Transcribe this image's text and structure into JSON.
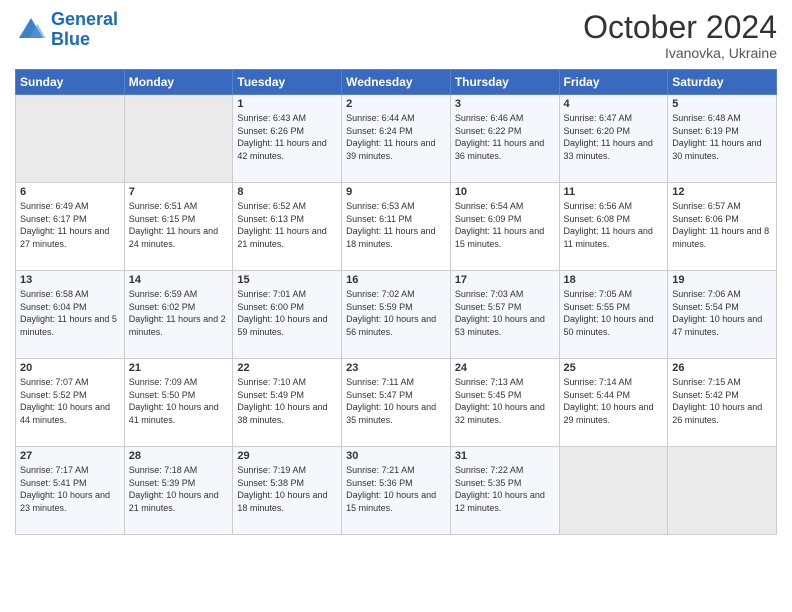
{
  "header": {
    "logo_line1": "General",
    "logo_line2": "Blue",
    "month": "October 2024",
    "location": "Ivanovka, Ukraine"
  },
  "weekdays": [
    "Sunday",
    "Monday",
    "Tuesday",
    "Wednesday",
    "Thursday",
    "Friday",
    "Saturday"
  ],
  "weeks": [
    [
      {
        "day": "",
        "info": ""
      },
      {
        "day": "",
        "info": ""
      },
      {
        "day": "1",
        "info": "Sunrise: 6:43 AM\nSunset: 6:26 PM\nDaylight: 11 hours and 42 minutes."
      },
      {
        "day": "2",
        "info": "Sunrise: 6:44 AM\nSunset: 6:24 PM\nDaylight: 11 hours and 39 minutes."
      },
      {
        "day": "3",
        "info": "Sunrise: 6:46 AM\nSunset: 6:22 PM\nDaylight: 11 hours and 36 minutes."
      },
      {
        "day": "4",
        "info": "Sunrise: 6:47 AM\nSunset: 6:20 PM\nDaylight: 11 hours and 33 minutes."
      },
      {
        "day": "5",
        "info": "Sunrise: 6:48 AM\nSunset: 6:19 PM\nDaylight: 11 hours and 30 minutes."
      }
    ],
    [
      {
        "day": "6",
        "info": "Sunrise: 6:49 AM\nSunset: 6:17 PM\nDaylight: 11 hours and 27 minutes."
      },
      {
        "day": "7",
        "info": "Sunrise: 6:51 AM\nSunset: 6:15 PM\nDaylight: 11 hours and 24 minutes."
      },
      {
        "day": "8",
        "info": "Sunrise: 6:52 AM\nSunset: 6:13 PM\nDaylight: 11 hours and 21 minutes."
      },
      {
        "day": "9",
        "info": "Sunrise: 6:53 AM\nSunset: 6:11 PM\nDaylight: 11 hours and 18 minutes."
      },
      {
        "day": "10",
        "info": "Sunrise: 6:54 AM\nSunset: 6:09 PM\nDaylight: 11 hours and 15 minutes."
      },
      {
        "day": "11",
        "info": "Sunrise: 6:56 AM\nSunset: 6:08 PM\nDaylight: 11 hours and 11 minutes."
      },
      {
        "day": "12",
        "info": "Sunrise: 6:57 AM\nSunset: 6:06 PM\nDaylight: 11 hours and 8 minutes."
      }
    ],
    [
      {
        "day": "13",
        "info": "Sunrise: 6:58 AM\nSunset: 6:04 PM\nDaylight: 11 hours and 5 minutes."
      },
      {
        "day": "14",
        "info": "Sunrise: 6:59 AM\nSunset: 6:02 PM\nDaylight: 11 hours and 2 minutes."
      },
      {
        "day": "15",
        "info": "Sunrise: 7:01 AM\nSunset: 6:00 PM\nDaylight: 10 hours and 59 minutes."
      },
      {
        "day": "16",
        "info": "Sunrise: 7:02 AM\nSunset: 5:59 PM\nDaylight: 10 hours and 56 minutes."
      },
      {
        "day": "17",
        "info": "Sunrise: 7:03 AM\nSunset: 5:57 PM\nDaylight: 10 hours and 53 minutes."
      },
      {
        "day": "18",
        "info": "Sunrise: 7:05 AM\nSunset: 5:55 PM\nDaylight: 10 hours and 50 minutes."
      },
      {
        "day": "19",
        "info": "Sunrise: 7:06 AM\nSunset: 5:54 PM\nDaylight: 10 hours and 47 minutes."
      }
    ],
    [
      {
        "day": "20",
        "info": "Sunrise: 7:07 AM\nSunset: 5:52 PM\nDaylight: 10 hours and 44 minutes."
      },
      {
        "day": "21",
        "info": "Sunrise: 7:09 AM\nSunset: 5:50 PM\nDaylight: 10 hours and 41 minutes."
      },
      {
        "day": "22",
        "info": "Sunrise: 7:10 AM\nSunset: 5:49 PM\nDaylight: 10 hours and 38 minutes."
      },
      {
        "day": "23",
        "info": "Sunrise: 7:11 AM\nSunset: 5:47 PM\nDaylight: 10 hours and 35 minutes."
      },
      {
        "day": "24",
        "info": "Sunrise: 7:13 AM\nSunset: 5:45 PM\nDaylight: 10 hours and 32 minutes."
      },
      {
        "day": "25",
        "info": "Sunrise: 7:14 AM\nSunset: 5:44 PM\nDaylight: 10 hours and 29 minutes."
      },
      {
        "day": "26",
        "info": "Sunrise: 7:15 AM\nSunset: 5:42 PM\nDaylight: 10 hours and 26 minutes."
      }
    ],
    [
      {
        "day": "27",
        "info": "Sunrise: 7:17 AM\nSunset: 5:41 PM\nDaylight: 10 hours and 23 minutes."
      },
      {
        "day": "28",
        "info": "Sunrise: 7:18 AM\nSunset: 5:39 PM\nDaylight: 10 hours and 21 minutes."
      },
      {
        "day": "29",
        "info": "Sunrise: 7:19 AM\nSunset: 5:38 PM\nDaylight: 10 hours and 18 minutes."
      },
      {
        "day": "30",
        "info": "Sunrise: 7:21 AM\nSunset: 5:36 PM\nDaylight: 10 hours and 15 minutes."
      },
      {
        "day": "31",
        "info": "Sunrise: 7:22 AM\nSunset: 5:35 PM\nDaylight: 10 hours and 12 minutes."
      },
      {
        "day": "",
        "info": ""
      },
      {
        "day": "",
        "info": ""
      }
    ]
  ]
}
